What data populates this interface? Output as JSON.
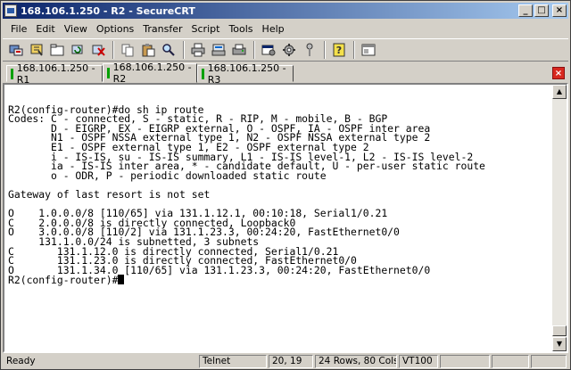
{
  "window": {
    "title": "168.106.1.250 - R2 - SecureCRT",
    "minimize_glyph": "_",
    "maximize_glyph": "□",
    "close_glyph": "×"
  },
  "menu": [
    "File",
    "Edit",
    "View",
    "Options",
    "Transfer",
    "Script",
    "Tools",
    "Help"
  ],
  "toolbar": {
    "icons": [
      "connect-icon",
      "quick-connect-icon",
      "connect-tab-icon",
      "reconnect-icon",
      "disconnect-icon",
      "copy-icon",
      "paste-icon",
      "find-icon",
      "print-icon",
      "print-selection-icon",
      "print-screen-icon",
      "session-options-icon",
      "global-options-icon",
      "keymap-icon",
      "help-icon",
      "new-window-icon"
    ]
  },
  "tabs": [
    {
      "label": "168.106.1.250 - R1",
      "active": false
    },
    {
      "label": "168.106.1.250 - R2",
      "active": true
    },
    {
      "label": "168.106.1.250 - R3",
      "active": false
    }
  ],
  "tab_close_glyph": "×",
  "terminal": {
    "lines": [
      "",
      "R2(config-router)#do sh ip route",
      "Codes: C - connected, S - static, R - RIP, M - mobile, B - BGP",
      "       D - EIGRP, EX - EIGRP external, O - OSPF, IA - OSPF inter area",
      "       N1 - OSPF NSSA external type 1, N2 - OSPF NSSA external type 2",
      "       E1 - OSPF external type 1, E2 - OSPF external type 2",
      "       i - IS-IS, su - IS-IS summary, L1 - IS-IS level-1, L2 - IS-IS level-2",
      "       ia - IS-IS inter area, * - candidate default, U - per-user static route",
      "       o - ODR, P - periodic downloaded static route",
      "",
      "Gateway of last resort is not set",
      "",
      "O    1.0.0.0/8 [110/65] via 131.1.12.1, 00:10:18, Serial1/0.21",
      "C    2.0.0.0/8 is directly connected, Loopback0",
      "O    3.0.0.0/8 [110/2] via 131.1.23.3, 00:24:20, FastEthernet0/0",
      "     131.1.0.0/24 is subnetted, 3 subnets",
      "C       131.1.12.0 is directly connected, Serial1/0.21",
      "C       131.1.23.0 is directly connected, FastEthernet0/0",
      "O       131.1.34.0 [110/65] via 131.1.23.3, 00:24:20, FastEthernet0/0"
    ],
    "prompt": "R2(config-router)#"
  },
  "statusbar": {
    "status": "Ready",
    "protocol": "Telnet",
    "cursor_pos": "20, 19",
    "size": "24 Rows, 80 Cols",
    "emulation": "VT100"
  }
}
